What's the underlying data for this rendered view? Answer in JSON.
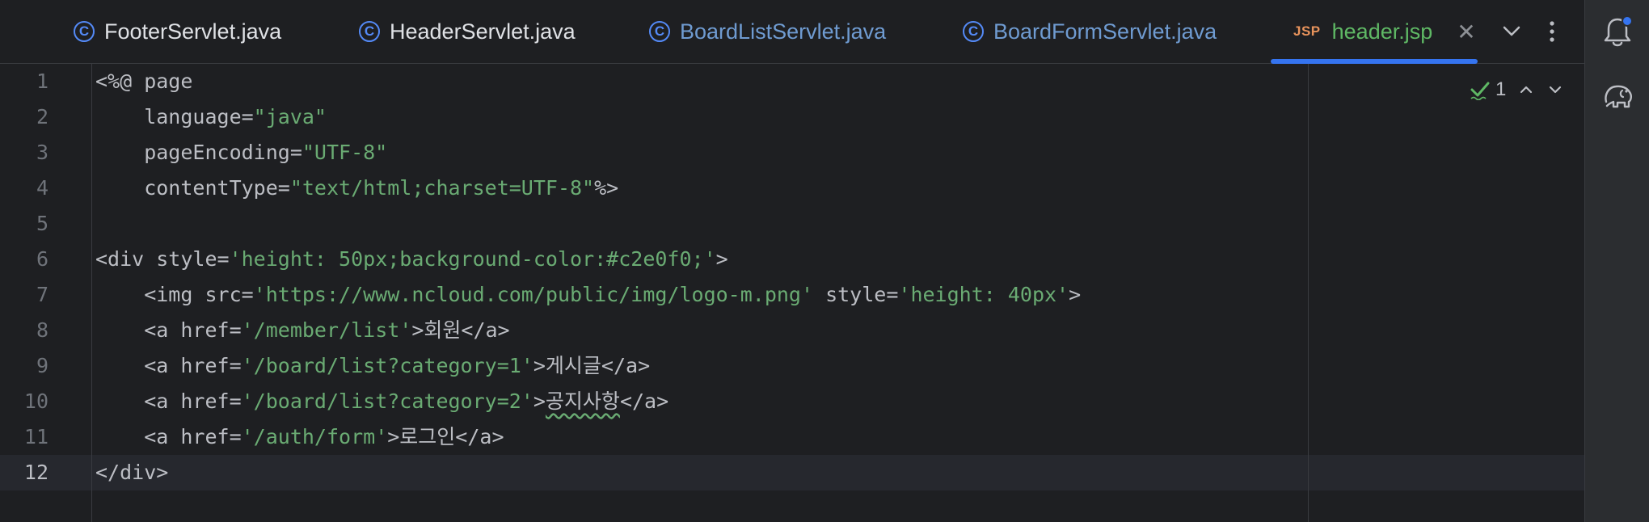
{
  "tabs": [
    {
      "label": "FooterServlet.java",
      "icon": "java-class-icon",
      "color": "#dfe1e5"
    },
    {
      "label": "HeaderServlet.java",
      "icon": "java-class-icon",
      "color": "#dfe1e5"
    },
    {
      "label": "BoardListServlet.java",
      "icon": "java-class-icon",
      "color": "#6f9bd1"
    },
    {
      "label": "BoardFormServlet.java",
      "icon": "java-class-icon",
      "color": "#6f9bd1"
    },
    {
      "label": "header.jsp",
      "icon": "jsp-file-icon",
      "icon_text": "JSP",
      "color": "#5fb865",
      "active": true
    }
  ],
  "inspection": {
    "count": "1"
  },
  "editor": {
    "current_line": "12",
    "lines": [
      {
        "num": "1",
        "segments": [
          {
            "t": "<%@ page"
          }
        ]
      },
      {
        "num": "2",
        "segments": [
          {
            "t": "    language="
          },
          {
            "t": "\"java\"",
            "s": true
          }
        ]
      },
      {
        "num": "3",
        "segments": [
          {
            "t": "    pageEncoding="
          },
          {
            "t": "\"UTF-8\"",
            "s": true
          }
        ]
      },
      {
        "num": "4",
        "segments": [
          {
            "t": "    contentType="
          },
          {
            "t": "\"text/html;charset=UTF-8\"",
            "s": true
          },
          {
            "t": "%>"
          }
        ]
      },
      {
        "num": "5",
        "segments": []
      },
      {
        "num": "6",
        "segments": [
          {
            "t": "<div style="
          },
          {
            "t": "'height: 50px;background-color:#c2e0f0;'",
            "s": true
          },
          {
            "t": ">"
          }
        ]
      },
      {
        "num": "7",
        "segments": [
          {
            "t": "    <img src="
          },
          {
            "t": "'https://www.ncloud.com/public/img/logo-m.png'",
            "s": true
          },
          {
            "t": " style="
          },
          {
            "t": "'height: 40px'",
            "s": true
          },
          {
            "t": ">"
          }
        ]
      },
      {
        "num": "8",
        "segments": [
          {
            "t": "    <a href="
          },
          {
            "t": "'/member/list'",
            "s": true
          },
          {
            "t": ">회원</a>"
          }
        ]
      },
      {
        "num": "9",
        "segments": [
          {
            "t": "    <a href="
          },
          {
            "t": "'/board/list?category=1'",
            "s": true
          },
          {
            "t": ">게시글</a>"
          }
        ]
      },
      {
        "num": "10",
        "segments": [
          {
            "t": "    <a href="
          },
          {
            "t": "'/board/list?category=2'",
            "s": true
          },
          {
            "t": ">"
          },
          {
            "t": "공지사항",
            "squig": true
          },
          {
            "t": "</a>"
          }
        ]
      },
      {
        "num": "11",
        "segments": [
          {
            "t": "    <a href="
          },
          {
            "t": "'/auth/form'",
            "s": true
          },
          {
            "t": ">로그인</a>"
          }
        ]
      },
      {
        "num": "12",
        "segments": [
          {
            "t": "</div>"
          }
        ]
      }
    ]
  },
  "colors": {
    "background": "#1e1f22",
    "string": "#6aab73",
    "accent": "#3574f0",
    "text": "#bcbec4"
  }
}
